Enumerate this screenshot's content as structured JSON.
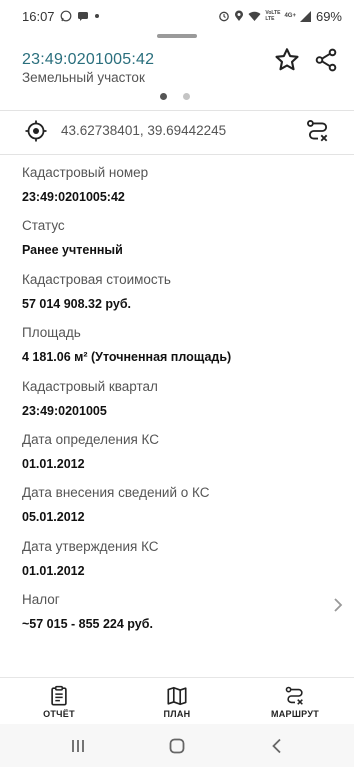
{
  "status_bar": {
    "time": "16:07",
    "battery": "69%",
    "left_icons": [
      "whatsapp-icon",
      "chat-icon",
      "dot-icon"
    ],
    "right_icons": [
      "alarm-icon",
      "location-icon",
      "wifi-icon",
      "volte-icon",
      "4g-icon",
      "signal-icon",
      "battery-icon"
    ],
    "net_labels": {
      "volte": "VoLTE",
      "lte": "LTE",
      "g4": "4G+"
    }
  },
  "header": {
    "title": "23:49:0201005:42",
    "subtitle": "Земельный участок",
    "page_count": 2,
    "active_page": 0
  },
  "coordinates": "43.62738401, 39.69442245",
  "fields": [
    {
      "label": "Кадастровый номер",
      "value": "23:49:0201005:42"
    },
    {
      "label": "Статус",
      "value": "Ранее учтенный"
    },
    {
      "label": "Кадастровая стоимость",
      "value": "57 014 908.32 руб."
    },
    {
      "label": "Площадь",
      "value": "4 181.06 м² (Уточненная площадь)"
    },
    {
      "label": "Кадастровый квартал",
      "value": "23:49:0201005"
    },
    {
      "label": "Дата определения КС",
      "value": "01.01.2012"
    },
    {
      "label": "Дата внесения сведений о КС",
      "value": "05.01.2012"
    },
    {
      "label": "Дата утверждения КС",
      "value": "01.01.2012"
    },
    {
      "label": "Налог",
      "value": "~57 015 - 855 224 руб."
    }
  ],
  "bottom_nav": [
    {
      "label": "ОТЧЁТ",
      "icon": "report-icon"
    },
    {
      "label": "ПЛАН",
      "icon": "map-icon"
    },
    {
      "label": "МАРШРУТ",
      "icon": "route-icon"
    }
  ],
  "colors": {
    "accent": "#2a6f7d"
  }
}
